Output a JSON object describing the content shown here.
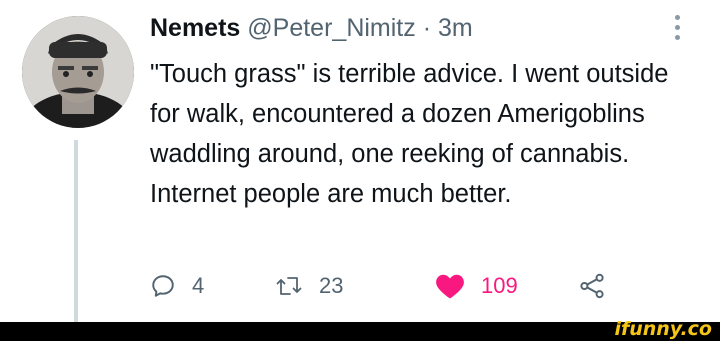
{
  "tweet": {
    "author_name": "Nemets",
    "handle": "@Peter_Nimitz",
    "separator": "·",
    "time": "3m",
    "text": "\"Touch grass\" is terrible advice. I went outside for walk, encountered a dozen Amerigoblins waddling around, one reeking of cannabis. Internet people are much better.",
    "actions": {
      "reply_count": "4",
      "retweet_count": "23",
      "like_count": "109"
    }
  },
  "icons": {
    "reply": "reply-icon",
    "retweet": "retweet-icon",
    "like": "heart-icon",
    "share": "share-icon",
    "more": "more-options-icon"
  },
  "colors": {
    "like_active": "#f91880",
    "secondary_text": "#536471",
    "thread_line": "#cfd9de"
  },
  "watermark": {
    "text": "ifunny.co"
  }
}
